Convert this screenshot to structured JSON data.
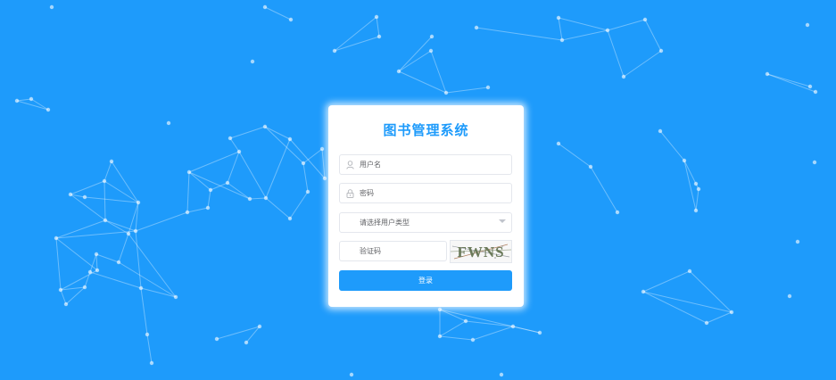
{
  "app": {
    "title": "图书管理系统"
  },
  "form": {
    "username_placeholder": "用户名",
    "password_placeholder": "密码",
    "user_type_placeholder": "请选择用户类型",
    "captcha_placeholder": "验证码",
    "captcha_text": "FWNS",
    "submit_label": "登录"
  },
  "icons": {
    "username": "user-icon",
    "password": "lock-icon",
    "user_type": "chevron-down-icon"
  },
  "colors": {
    "background": "#1e9bfb",
    "accent": "#1e9bfb",
    "card": "#ffffff"
  }
}
